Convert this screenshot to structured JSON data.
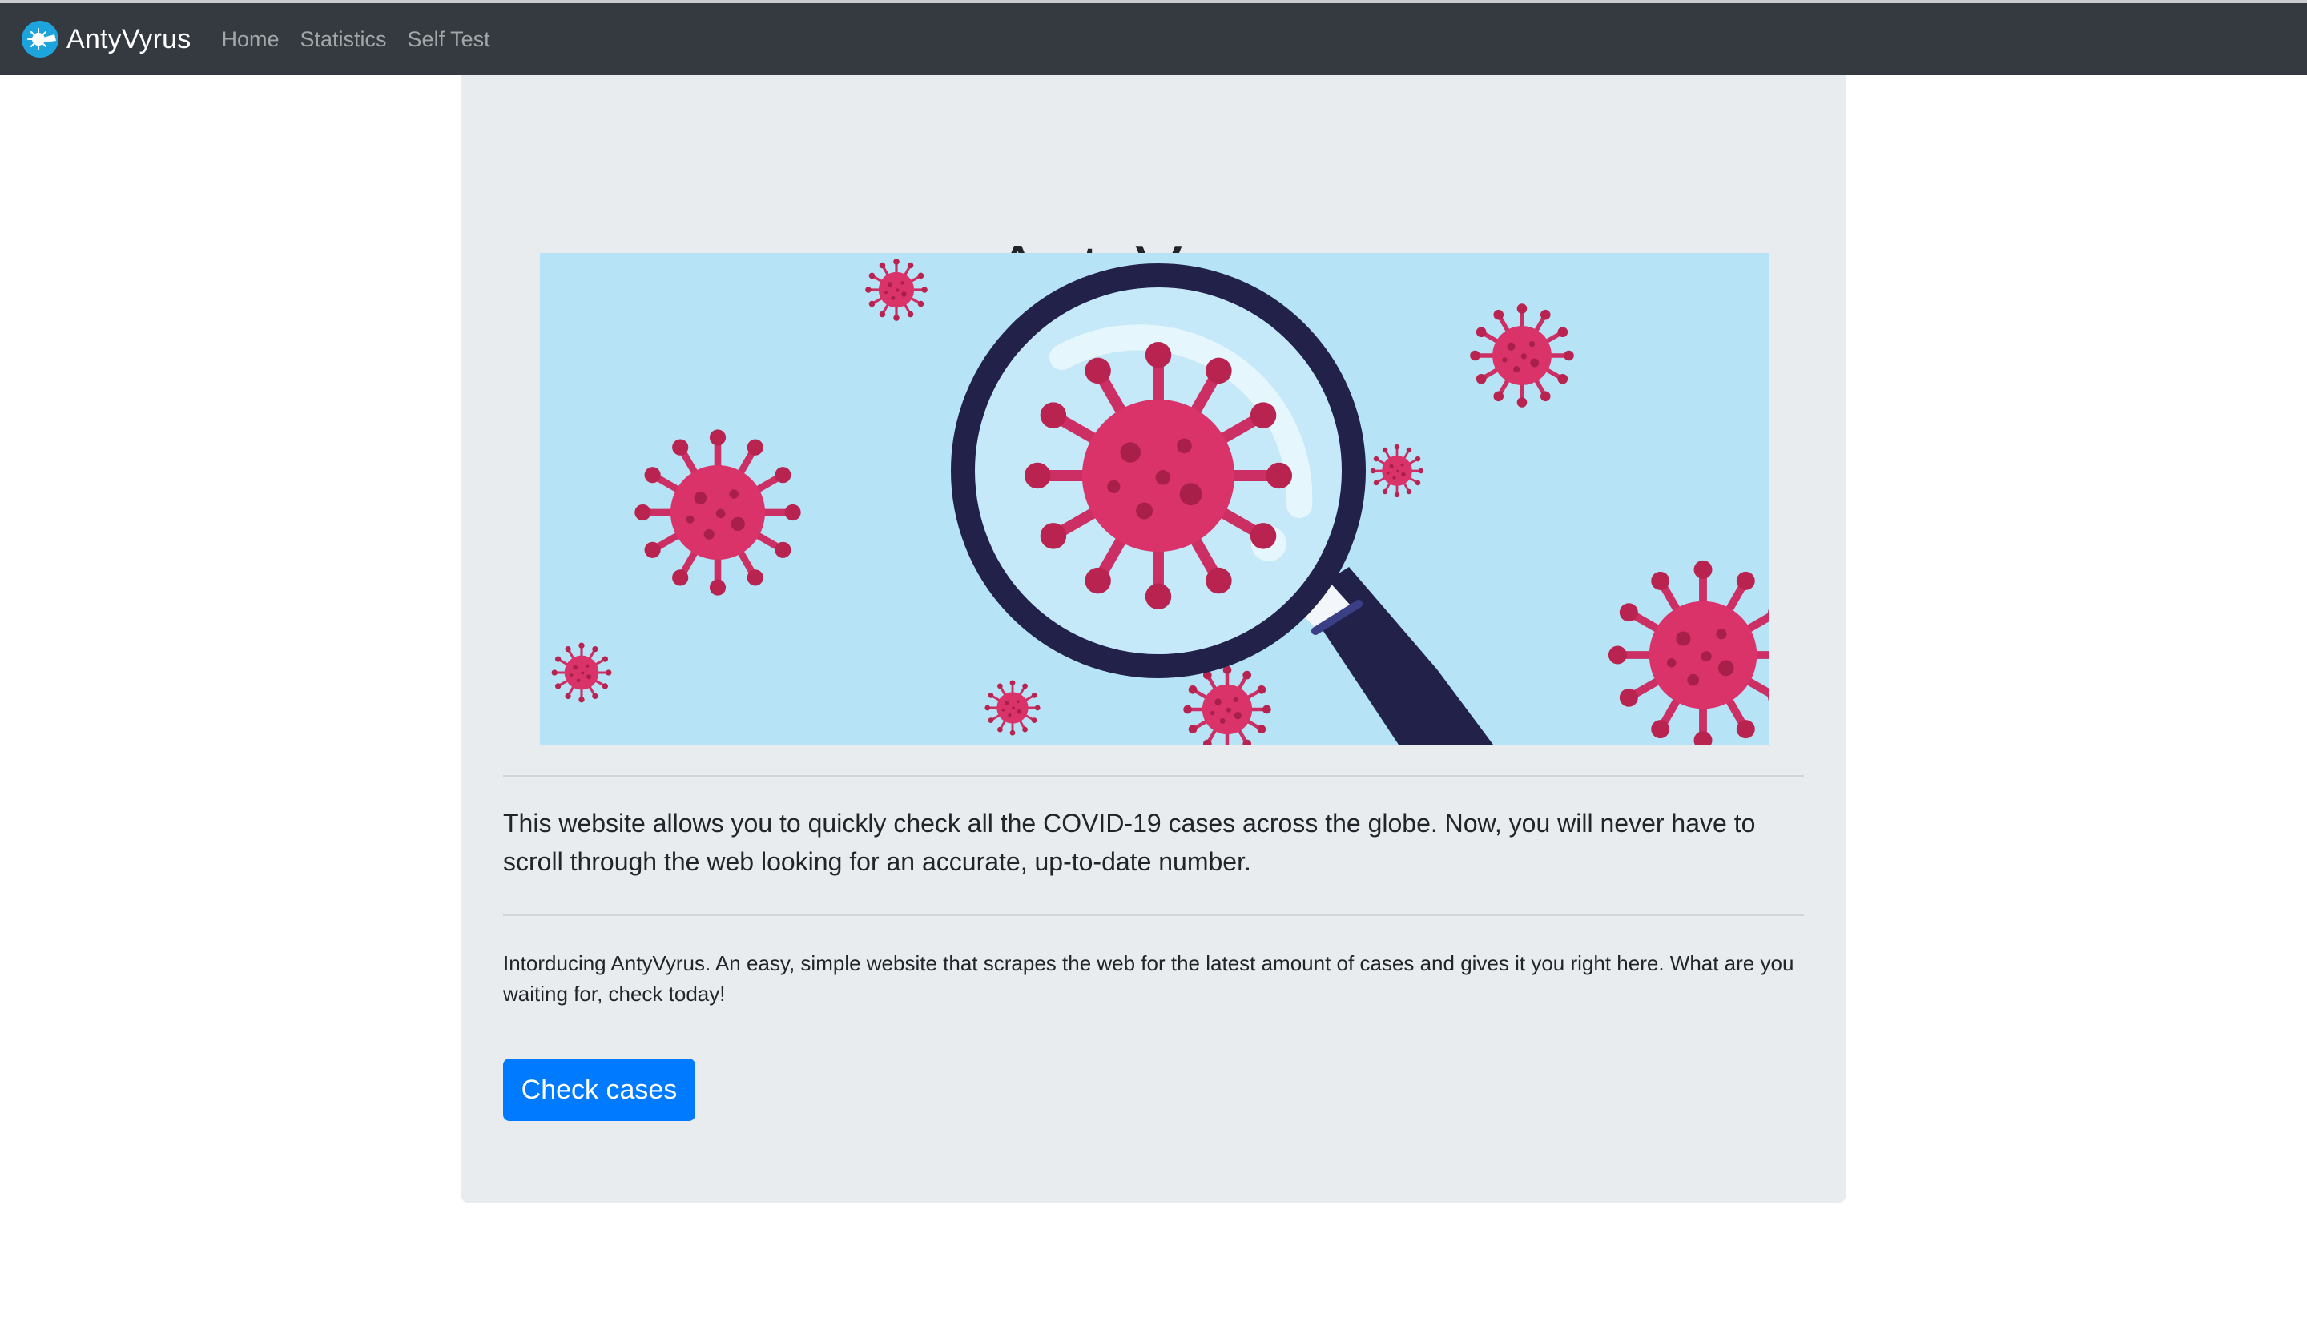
{
  "navbar": {
    "brand": "AntyVyrus",
    "links": [
      "Home",
      "Statistics",
      "Self Test"
    ]
  },
  "hero": {
    "title": "AntyVyrus",
    "lead": "This website allows you to quickly check all the COVID-19 cases across the globe. Now, you will never have to scroll through the web looking for an accurate, up-to-date number.",
    "description": "Intorducing AntyVyrus. An easy, simple website that scrapes the web for the latest amount of cases and gives it you right here. What are you waiting for, check today!",
    "button_label": "Check cases"
  },
  "colors": {
    "navbar_bg": "#343a40",
    "jumbotron_bg": "#e9ecef",
    "button_bg": "#007bff",
    "image_bg": "#b7e3f7",
    "virus": "#d9336a",
    "magnifier": "#23234a"
  }
}
